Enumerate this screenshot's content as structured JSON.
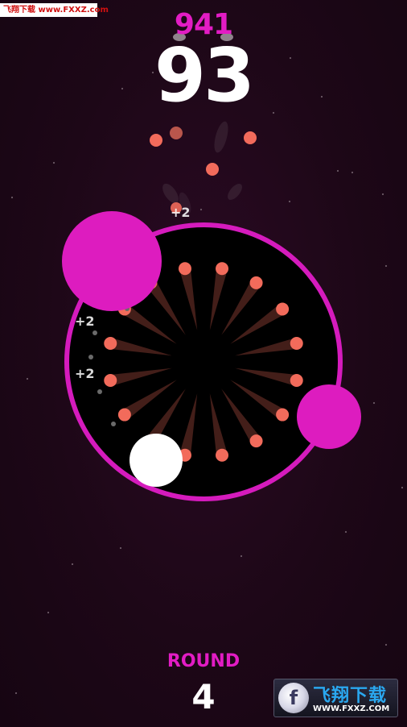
{
  "watermark_top": "飞翔下载 www.FXXZ.com",
  "best_score": "941",
  "score": "93",
  "popups": [
    "+2",
    "+2",
    "+2"
  ],
  "round_label": "ROUND",
  "round_value": "4",
  "watermark_bottom": {
    "title": "飞翔下载",
    "url": "WWW.FXXZ.COM"
  },
  "colors": {
    "background": "#1e0818",
    "accent_magenta": "#e21cc4",
    "ball": "#f26b5b",
    "player": "#ffffff",
    "arena": "#000000"
  }
}
